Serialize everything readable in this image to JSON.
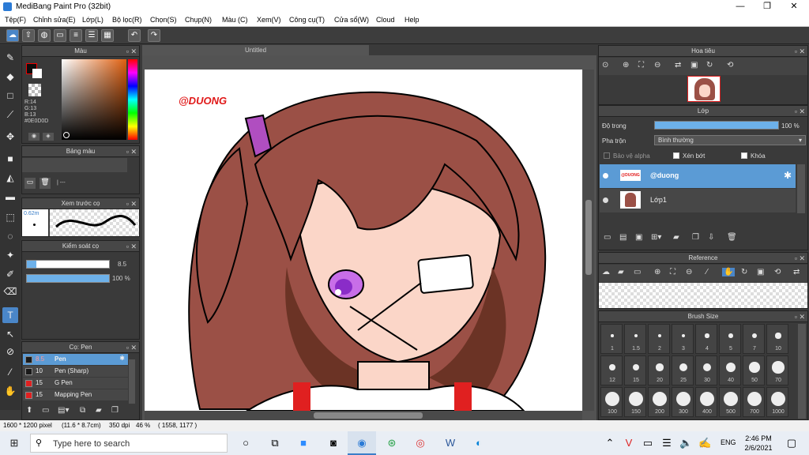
{
  "window": {
    "title": "MediBang Paint Pro (32bit)",
    "minimize": "—",
    "maximize": "❐",
    "close": "✕"
  },
  "menu": [
    "Tệp(F)",
    "Chỉnh sửa(E)",
    "Lớp(L)",
    "Bộ lọc(R)",
    "Chọn(S)",
    "Chụp(N)",
    "Màu (C)",
    "Xem(V)",
    "Công cụ(T)",
    "Cửa sổ(W)",
    "Cloud",
    "Help"
  ],
  "canvas": {
    "tab": "Untitled",
    "watermark": "@DUONG"
  },
  "color_panel": {
    "title": "Màu",
    "rgb": [
      "R:14",
      "G:13",
      "B:13"
    ],
    "hex": "#0E0D0D"
  },
  "palette_panel": {
    "title": "Bảng màu",
    "placeholder": "| ---"
  },
  "preview_panel": {
    "title": "Xem trước cọ",
    "size": "0.62m"
  },
  "control_panel": {
    "title": "Kiểm soát cọ",
    "size_value": "8.5",
    "opacity_value": "100 %",
    "opacity_fraction": 1.0,
    "size_fraction": 0.12
  },
  "brush_panel": {
    "title": "Cọ: Pen",
    "items": [
      {
        "size": "8.5",
        "name": "Pen",
        "color": "#1a1a1a",
        "selected": true
      },
      {
        "size": "10",
        "name": "Pen (Sharp)",
        "color": "#1a1a1a",
        "selected": false
      },
      {
        "size": "15",
        "name": "G Pen",
        "color": "#e02020",
        "selected": false
      },
      {
        "size": "15",
        "name": "Mapping Pen",
        "color": "#e02020",
        "selected": false
      }
    ]
  },
  "navigator": {
    "title": "Hoa tiêu"
  },
  "layer_panel": {
    "title": "Lớp",
    "opacity_label": "Độ trong",
    "opacity_value": "100 %",
    "opacity_fraction": 1.0,
    "blend_label": "Pha trộn",
    "blend_value": "Bình thường",
    "protect_alpha": "Bảo vệ alpha",
    "clipping": "Xén bớt",
    "lock": "Khóa",
    "layers": [
      {
        "name": "@duong",
        "thumb_text": "@DUONG",
        "selected": true
      },
      {
        "name": "Lớp1",
        "selected": false
      }
    ]
  },
  "reference_panel": {
    "title": "Reference"
  },
  "brush_size_panel": {
    "title": "Brush Size",
    "sizes": [
      "1",
      "1.5",
      "2",
      "3",
      "4",
      "5",
      "7",
      "10",
      "12",
      "15",
      "20",
      "25",
      "30",
      "40",
      "50",
      "70",
      "100",
      "150",
      "200",
      "300",
      "400",
      "500",
      "700",
      "1000"
    ]
  },
  "status": {
    "dimensions": "1600 * 1200 pixel",
    "size_cm": "(11.6 * 8.7cm)",
    "dpi": "350 dpi",
    "zoom": "46 %",
    "coords": "( 1558, 1177 )"
  },
  "taskbar": {
    "search_placeholder": "Type here to search",
    "lang": "ENG",
    "time": "2:46 PM",
    "date": "2/6/2021"
  }
}
